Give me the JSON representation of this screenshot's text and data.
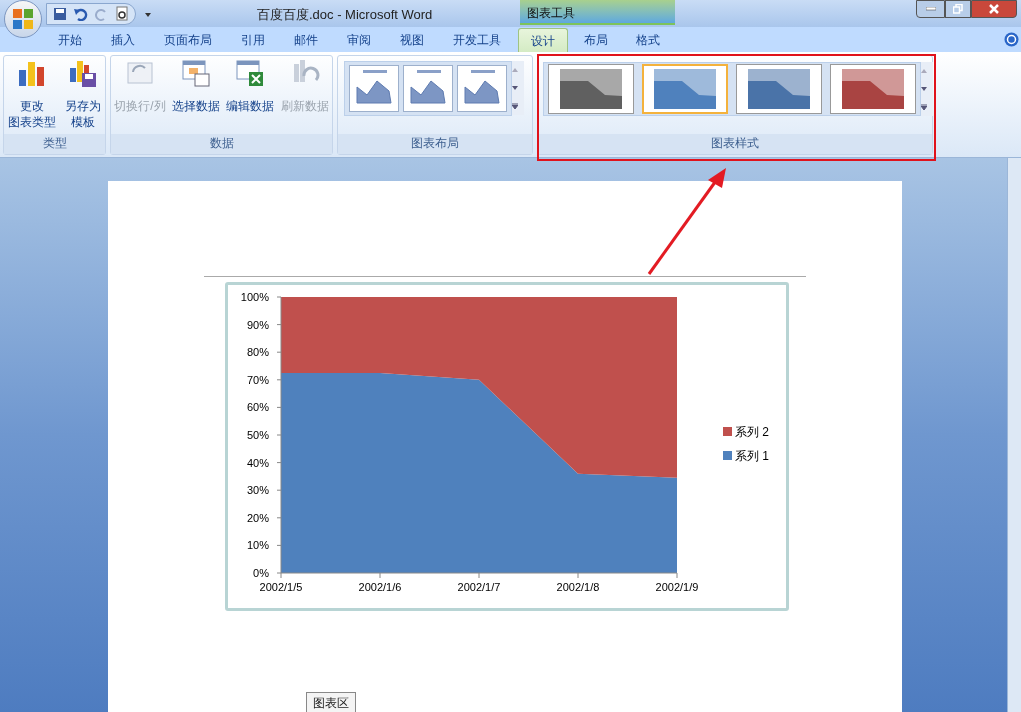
{
  "window": {
    "title": "百度百度.doc - Microsoft Word",
    "context_title": "图表工具"
  },
  "tabs": [
    {
      "label": "开始",
      "selected": false
    },
    {
      "label": "插入",
      "selected": false
    },
    {
      "label": "页面布局",
      "selected": false
    },
    {
      "label": "引用",
      "selected": false
    },
    {
      "label": "邮件",
      "selected": false
    },
    {
      "label": "审阅",
      "selected": false
    },
    {
      "label": "视图",
      "selected": false
    },
    {
      "label": "开发工具",
      "selected": false
    },
    {
      "label": "设计",
      "selected": true
    },
    {
      "label": "布局",
      "selected": false
    },
    {
      "label": "格式",
      "selected": false
    }
  ],
  "ribbon_groups": [
    {
      "name": "类型",
      "buttons": [
        {
          "lines": [
            "更改",
            "图表类型"
          ],
          "kind": "chart",
          "disabled": false
        },
        {
          "lines": [
            "另存为",
            "模板"
          ],
          "kind": "save",
          "disabled": false
        }
      ]
    },
    {
      "name": "数据",
      "buttons": [
        {
          "label": "切换行/列",
          "kind": "switch",
          "disabled": true
        },
        {
          "label": "选择数据",
          "kind": "select",
          "disabled": false
        },
        {
          "label": "编辑数据",
          "kind": "excel",
          "disabled": false
        },
        {
          "label": "刷新数据",
          "kind": "refresh",
          "disabled": true
        }
      ]
    }
  ],
  "layouts": {
    "name": "图表布局"
  },
  "styles": {
    "name": "图表样式",
    "items": [
      {
        "selected": false,
        "color": "#606060"
      },
      {
        "selected": true,
        "color": "#4f81bd"
      },
      {
        "selected": false,
        "color": "#4a73a8"
      },
      {
        "selected": false,
        "color": "#a94442"
      }
    ]
  },
  "chart": {
    "chart_data": {
      "type": "area",
      "stacked": true,
      "categories": [
        "2002/1/5",
        "2002/1/6",
        "2002/1/7",
        "2002/1/8",
        "2002/1/9"
      ],
      "series": [
        {
          "name": "系列 1",
          "color": "#4f81bd",
          "values": [
            72.5,
            72.5,
            70,
            36,
            34.5
          ]
        },
        {
          "name": "系列 2",
          "color": "#c0504d",
          "values": [
            27.5,
            27.5,
            30,
            64,
            65.5
          ]
        }
      ],
      "ylim": [
        0,
        100
      ],
      "legend": "right",
      "yticks": [
        {
          "value": 0,
          "label": "0%"
        },
        {
          "value": 10,
          "label": "10%"
        },
        {
          "value": 20,
          "label": "20%"
        },
        {
          "value": 30,
          "label": "30%"
        },
        {
          "value": 40,
          "label": "40%"
        },
        {
          "value": 50,
          "label": "50%"
        },
        {
          "value": 60,
          "label": "60%"
        },
        {
          "value": 70,
          "label": "70%"
        },
        {
          "value": 80,
          "label": "80%"
        },
        {
          "value": 90,
          "label": "90%"
        },
        {
          "value": 100,
          "label": "100%"
        }
      ]
    }
  },
  "tooltip": "图表区"
}
